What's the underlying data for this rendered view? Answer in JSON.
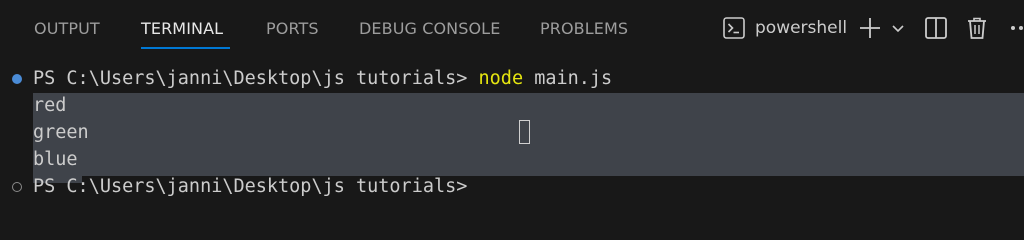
{
  "panel": {
    "tabs": [
      {
        "label": "OUTPUT",
        "active": false
      },
      {
        "label": "TERMINAL",
        "active": true
      },
      {
        "label": "PORTS",
        "active": false
      },
      {
        "label": "DEBUG CONSOLE",
        "active": false
      },
      {
        "label": "PROBLEMS",
        "active": false
      }
    ],
    "actions": {
      "shell_label": "powershell",
      "icons": [
        "terminal-icon",
        "plus-icon",
        "chevron-down-icon",
        "split-icon",
        "trash-icon",
        "more-icon"
      ]
    }
  },
  "terminal": {
    "prompt1": "PS C:\\Users\\janni\\Desktop\\js tutorials> ",
    "command_name": "node",
    "command_args": " main.js",
    "output": [
      "red",
      "green",
      "blue"
    ],
    "prompt2": "PS C:\\Users\\janni\\Desktop\\js tutorials>"
  },
  "colors": {
    "accent": "#0078d4",
    "command": "#e5e510",
    "selection": "#3f434a",
    "decoration_success": "#4a8bd6"
  }
}
